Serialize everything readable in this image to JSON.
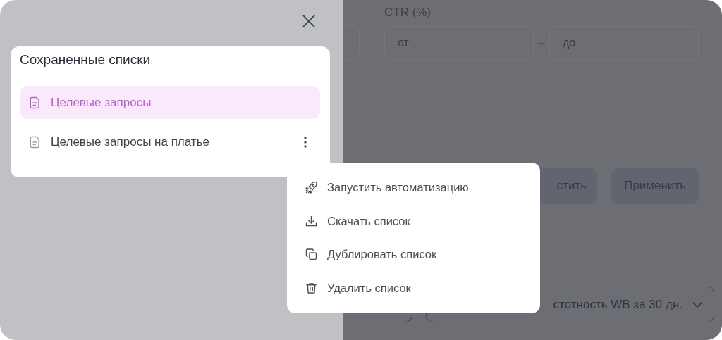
{
  "saved_lists": {
    "title": "Сохраненные списки",
    "items": [
      {
        "label": "Целевые запросы",
        "selected": true,
        "actions_visible": false
      },
      {
        "label": "Целевые запросы на платье",
        "selected": false,
        "actions_visible": true
      }
    ]
  },
  "context_menu": {
    "items": [
      {
        "kind": "rocket",
        "label": "Запустить автоматизацию"
      },
      {
        "kind": "download",
        "label": "Скачать список"
      },
      {
        "kind": "copy",
        "label": "Дублировать список"
      },
      {
        "kind": "trash",
        "label": "Удалить список"
      }
    ]
  },
  "background": {
    "ctr_filter": {
      "label": "CTR (%)",
      "from": {
        "placeholder": "от"
      },
      "to": {
        "placeholder": "до"
      }
    },
    "buttons": [
      "стить",
      "Применить"
    ],
    "sort_select": {
      "value": "стотность WB за 30 дн."
    }
  }
}
